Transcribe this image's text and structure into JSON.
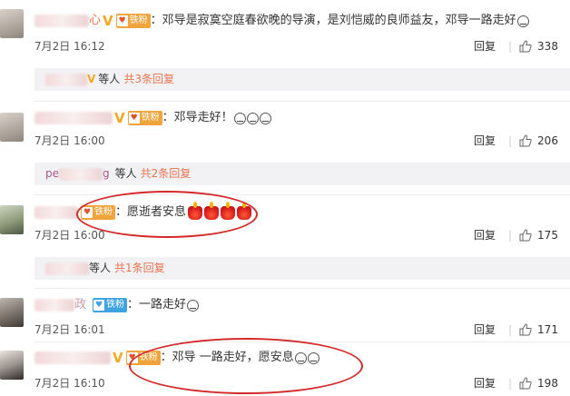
{
  "comments": [
    {
      "name": "心",
      "fan": "铁粉",
      "content": "：邓导是寂寞空庭春欲晚的导演，是刘恺威的良师益友，邓导一路走好",
      "time": "7月2日 16:12",
      "reply": "回复",
      "likes": "338"
    },
    {
      "name": "",
      "fan": "铁粉",
      "content": "：邓导走好！",
      "time": "7月2日 16:00",
      "reply": "回复",
      "likes": "206"
    },
    {
      "name": "",
      "fan": "铁粉",
      "content": "：愿逝者安息",
      "time": "7月2日 16:00",
      "reply": "回复",
      "likes": "175"
    },
    {
      "name": "政",
      "fan": "铁粉",
      "content": "：一路走好",
      "time": "7月2日 16:01",
      "reply": "回复",
      "likes": "171"
    },
    {
      "name": "",
      "fan": "铁粉",
      "content": "：邓导 一路走好，愿安息",
      "time": "7月2日 16:10",
      "reply": "回复",
      "likes": "198"
    }
  ],
  "reply_bars": [
    {
      "name": "",
      "suffix": "等人",
      "total": "共3条回复"
    },
    {
      "name": "pe",
      "name_tail": "g",
      "suffix": "等人",
      "total": "共2条回复"
    },
    {
      "name": "",
      "suffix": "等人",
      "total": "共1条回复"
    }
  ],
  "colors": {
    "accent": "#eb7350",
    "annotation": "#d42a2a"
  }
}
